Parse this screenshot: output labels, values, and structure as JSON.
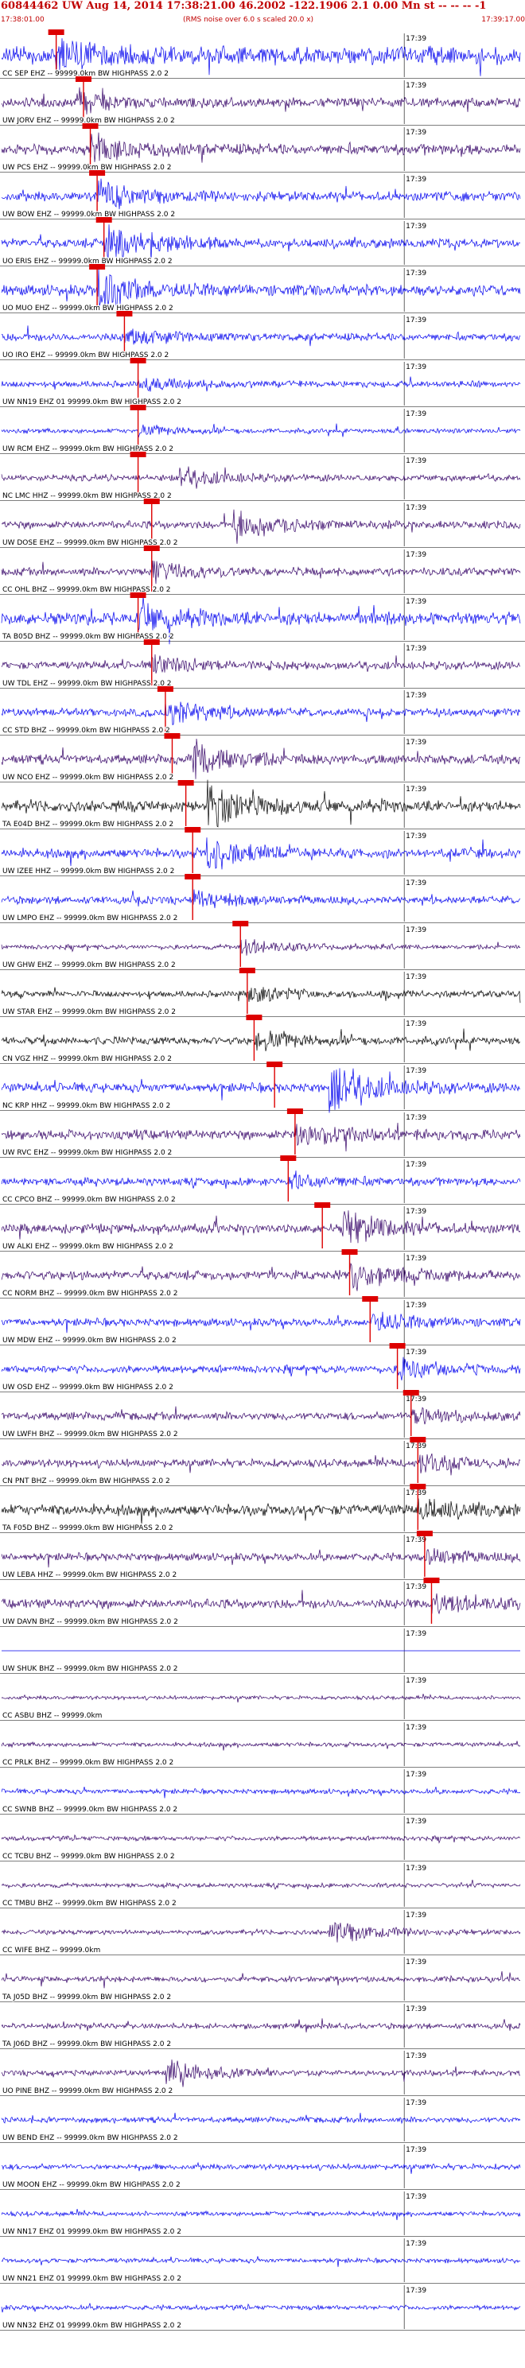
{
  "header": {
    "title": "60844462 UW Aug 14, 2014 17:38:21.00    46.2002 -122.1906  2.1 0.00 Mn st -- -- --  -1",
    "start_time": "17:38:01.00",
    "end_time": "17:39:17.00",
    "rms_note": "(RMS noise over 6.0 s scaled 20.0 x)"
  },
  "colors": {
    "header_red": "#c00000",
    "pick_marker": "#dd0000",
    "trace_colors": [
      "#0000ee",
      "#330066",
      "#000000"
    ]
  },
  "chart_data": {
    "type": "line",
    "title": "60844462 UW Aug 14, 2014 17:38:21.00    46.2002 -122.1906  2.1 0.00 Mn st -- -- --  -1",
    "time_marker_label": "17:39",
    "grid": false,
    "traces": [
      {
        "label": "CC SEP EHZ -- 99999.0km BW  HIGHPASS  2.0  2",
        "color": "#0000ee",
        "amp": 0.55,
        "pick_s": 8,
        "burst_s": 8,
        "burst_amp": 1.0,
        "pick": true
      },
      {
        "label": "UW JORV EHZ -- 99999.0km BW  HIGHPASS  2.0  2",
        "color": "#330066",
        "amp": 0.3,
        "pick_s": 12,
        "burst_s": 11,
        "burst_amp": 0.6,
        "pick": true
      },
      {
        "label": "UW PCS EHZ -- 99999.0km BW  HIGHPASS  2.0  2",
        "color": "#330066",
        "amp": 0.35,
        "pick_s": 13,
        "burst_s": 13,
        "burst_amp": 0.9,
        "pick": true
      },
      {
        "label": "UW BOW EHZ -- 99999.0km BW  HIGHPASS  2.0  2",
        "color": "#0000ee",
        "amp": 0.3,
        "pick_s": 14,
        "burst_s": 14,
        "burst_amp": 0.9,
        "pick": true
      },
      {
        "label": "UO ERIS EHZ -- 99999.0km BW  HIGHPASS  2.0  2",
        "color": "#0000ee",
        "amp": 0.3,
        "pick_s": 15,
        "burst_s": 15,
        "burst_amp": 1.1,
        "pick": true
      },
      {
        "label": "UO MUO EHZ -- 99999.0km BW  HIGHPASS  2.0  2",
        "color": "#0000ee",
        "amp": 0.35,
        "pick_s": 14,
        "burst_s": 14,
        "burst_amp": 1.1,
        "pick": true
      },
      {
        "label": "UO IRO EHZ -- 99999.0km BW  HIGHPASS  2.0  2",
        "color": "#0000ee",
        "amp": 0.25,
        "pick_s": 18,
        "burst_s": 18,
        "burst_amp": 0.5,
        "pick": true
      },
      {
        "label": "UW NN19 EHZ 01 99999.0km BW  HIGHPASS  2.0  2",
        "color": "#0000ee",
        "amp": 0.2,
        "pick_s": 20,
        "burst_s": 20,
        "burst_amp": 0.4,
        "pick": true
      },
      {
        "label": "UW RCM EHZ -- 99999.0km BW  HIGHPASS  2.0  2",
        "color": "#0000ee",
        "amp": 0.15,
        "pick_s": 20,
        "burst_s": 20,
        "burst_amp": 0.3,
        "pick": true
      },
      {
        "label": "NC LMC HHZ -- 99999.0km BW  HIGHPASS  2.0  2",
        "color": "#330066",
        "amp": 0.2,
        "pick_s": 20,
        "burst_s": 26,
        "burst_amp": 0.6,
        "pick": true
      },
      {
        "label": "UW DOSE EHZ -- 99999.0km BW  HIGHPASS  2.0  2",
        "color": "#330066",
        "amp": 0.25,
        "pick_s": 22,
        "burst_s": 34,
        "burst_amp": 1.0,
        "pick": true
      },
      {
        "label": "CC OHL BHZ -- 99999.0km BW  HIGHPASS  2.0  2",
        "color": "#330066",
        "amp": 0.25,
        "pick_s": 22,
        "burst_s": 22,
        "burst_amp": 0.7,
        "pick": true
      },
      {
        "label": "TA B05D BHZ -- 99999.0km BW  HIGHPASS  2.0  2",
        "color": "#0000ee",
        "amp": 0.4,
        "pick_s": 20,
        "burst_s": 20,
        "burst_amp": 0.7,
        "pick": true
      },
      {
        "label": "UW TDL EHZ -- 99999.0km BW  HIGHPASS  2.0  2",
        "color": "#330066",
        "amp": 0.25,
        "pick_s": 22,
        "burst_s": 22,
        "burst_amp": 0.5,
        "pick": true
      },
      {
        "label": "CC STD BHZ -- 99999.0km BW  HIGHPASS  2.0  2",
        "color": "#0000ee",
        "amp": 0.25,
        "pick_s": 24,
        "burst_s": 24,
        "burst_amp": 0.9,
        "pick": true
      },
      {
        "label": "UW NCO EHZ -- 99999.0km BW  HIGHPASS  2.0  2",
        "color": "#330066",
        "amp": 0.3,
        "pick_s": 25,
        "burst_s": 28,
        "burst_amp": 1.1,
        "pick": true
      },
      {
        "label": "TA E04D BHZ -- 99999.0km BW  HIGHPASS  2.0  2",
        "color": "#000000",
        "amp": 0.35,
        "pick_s": 27,
        "burst_s": 30,
        "burst_amp": 1.4,
        "pick": true
      },
      {
        "label": "UW IZEE HHZ -- 99999.0km BW  HIGHPASS  2.0  2",
        "color": "#0000ee",
        "amp": 0.3,
        "pick_s": 28,
        "burst_s": 30,
        "burst_amp": 1.0,
        "pick": true
      },
      {
        "label": "UW LMPO EHZ -- 99999.0km BW  HIGHPASS  2.0  2",
        "color": "#0000ee",
        "amp": 0.25,
        "pick_s": 28,
        "burst_s": 28,
        "burst_amp": 0.5,
        "pick": true
      },
      {
        "label": "UW GHW EHZ -- 99999.0km BW  HIGHPASS  2.0  2",
        "color": "#330066",
        "amp": 0.15,
        "pick_s": 35,
        "burst_s": 35,
        "burst_amp": 0.5,
        "pick": true
      },
      {
        "label": "UW STAR EHZ -- 99999.0km BW  HIGHPASS  2.0  2",
        "color": "#000000",
        "amp": 0.2,
        "pick_s": 36,
        "burst_s": 36,
        "burst_amp": 0.5,
        "pick": true
      },
      {
        "label": "CN VGZ HHZ -- 99999.0km BW  HIGHPASS  2.0  2",
        "color": "#000000",
        "amp": 0.25,
        "pick_s": 37,
        "burst_s": 37,
        "burst_amp": 0.6,
        "pick": true
      },
      {
        "label": "NC KRP HHZ -- 99999.0km BW  HIGHPASS  2.0  2",
        "color": "#0000ee",
        "amp": 0.3,
        "pick_s": 40,
        "burst_s": 48,
        "burst_amp": 1.5,
        "pick": true
      },
      {
        "label": "UW RVC EHZ -- 99999.0km BW  HIGHPASS  2.0  2",
        "color": "#330066",
        "amp": 0.3,
        "pick_s": 43,
        "burst_s": 43,
        "burst_amp": 0.8,
        "pick": true
      },
      {
        "label": "CC CPCO BHZ -- 99999.0km BW  HIGHPASS  2.0  2",
        "color": "#0000ee",
        "amp": 0.25,
        "pick_s": 42,
        "burst_s": 42,
        "burst_amp": 0.5,
        "pick": true
      },
      {
        "label": "UW ALKI EHZ -- 99999.0km BW  HIGHPASS  2.0  2",
        "color": "#330066",
        "amp": 0.3,
        "pick_s": 47,
        "burst_s": 50,
        "burst_amp": 1.0,
        "pick": true
      },
      {
        "label": "CC NORM BHZ -- 99999.0km BW  HIGHPASS  2.0  2",
        "color": "#330066",
        "amp": 0.3,
        "pick_s": 51,
        "burst_s": 51,
        "burst_amp": 0.9,
        "pick": true
      },
      {
        "label": "UW MDW EHZ -- 99999.0km BW  HIGHPASS  2.0  2",
        "color": "#0000ee",
        "amp": 0.25,
        "pick_s": 54,
        "burst_s": 54,
        "burst_amp": 0.6,
        "pick": true
      },
      {
        "label": "UW OSD EHZ -- 99999.0km BW  HIGHPASS  2.0  2",
        "color": "#0000ee",
        "amp": 0.25,
        "pick_s": 58,
        "burst_s": 58,
        "burst_amp": 0.6,
        "pick": true
      },
      {
        "label": "UW LWFH BHZ -- 99999.0km BW  HIGHPASS  2.0  2",
        "color": "#330066",
        "amp": 0.25,
        "pick_s": 60,
        "burst_s": 60,
        "burst_amp": 0.5,
        "pick": true
      },
      {
        "label": "CN PNT BHZ -- 99999.0km BW  HIGHPASS  2.0  2",
        "color": "#330066",
        "amp": 0.25,
        "pick_s": 61,
        "burst_s": 61,
        "burst_amp": 0.6,
        "pick": true
      },
      {
        "label": "TA F05D BHZ -- 99999.0km BW  HIGHPASS  2.0  2",
        "color": "#000000",
        "amp": 0.35,
        "pick_s": 61,
        "burst_s": 61,
        "burst_amp": 0.6,
        "pick": true
      },
      {
        "label": "UW LEBA HHZ -- 99999.0km BW  HIGHPASS  2.0  2",
        "color": "#330066",
        "amp": 0.25,
        "pick_s": 62,
        "burst_s": 62,
        "burst_amp": 0.5,
        "pick": true
      },
      {
        "label": "UW DAVN BHZ -- 99999.0km BW  HIGHPASS  2.0  2",
        "color": "#330066",
        "amp": 0.3,
        "pick_s": 63,
        "burst_s": 63,
        "burst_amp": 0.6,
        "pick": true
      },
      {
        "label": "UW SHUK BHZ -- 99999.0km BW  HIGHPASS  2.0  2",
        "color": "#0000ee",
        "amp": 0.0,
        "pick_s": 0,
        "burst_s": 0,
        "burst_amp": 0.0,
        "pick": false
      },
      {
        "label": "CC ASBU BHZ -- 99999.0km",
        "color": "#330066",
        "amp": 0.12,
        "pick_s": 0,
        "burst_s": 0,
        "burst_amp": 0.0,
        "pick": false
      },
      {
        "label": "CC PRLK BHZ -- 99999.0km BW  HIGHPASS  2.0  2",
        "color": "#330066",
        "amp": 0.14,
        "pick_s": 0,
        "burst_s": 0,
        "burst_amp": 0.0,
        "pick": false
      },
      {
        "label": "CC SWNB BHZ -- 99999.0km BW  HIGHPASS  2.0  2",
        "color": "#0000ee",
        "amp": 0.16,
        "pick_s": 0,
        "burst_s": 0,
        "burst_amp": 0.0,
        "pick": false
      },
      {
        "label": "CC TCBU BHZ -- 99999.0km BW  HIGHPASS  2.0  2",
        "color": "#330066",
        "amp": 0.15,
        "pick_s": 0,
        "burst_s": 0,
        "burst_amp": 0.0,
        "pick": false
      },
      {
        "label": "CC TMBU BHZ -- 99999.0km BW  HIGHPASS  2.0  2",
        "color": "#330066",
        "amp": 0.14,
        "pick_s": 0,
        "burst_s": 0,
        "burst_amp": 0.0,
        "pick": false
      },
      {
        "label": "CC WIFE BHZ -- 99999.0km",
        "color": "#330066",
        "amp": 0.15,
        "pick_s": 0,
        "burst_s": 48,
        "burst_amp": 0.8,
        "pick": false
      },
      {
        "label": "TA J05D BHZ -- 99999.0km BW  HIGHPASS  2.0  2",
        "color": "#330066",
        "amp": 0.18,
        "pick_s": 0,
        "burst_s": 0,
        "burst_amp": 0.0,
        "pick": false
      },
      {
        "label": "TA J06D BHZ -- 99999.0km BW  HIGHPASS  2.0  2",
        "color": "#330066",
        "amp": 0.18,
        "pick_s": 0,
        "burst_s": 0,
        "burst_amp": 0.0,
        "pick": false
      },
      {
        "label": "UO PINE BHZ -- 99999.0km BW  HIGHPASS  2.0  2",
        "color": "#330066",
        "amp": 0.18,
        "pick_s": 0,
        "burst_s": 24,
        "burst_amp": 0.8,
        "pick": false
      },
      {
        "label": "UW BEND EHZ -- 99999.0km BW  HIGHPASS  2.0  2",
        "color": "#0000ee",
        "amp": 0.18,
        "pick_s": 0,
        "burst_s": 0,
        "burst_amp": 0.0,
        "pick": false
      },
      {
        "label": "UW MOON EHZ -- 99999.0km BW  HIGHPASS  2.0  2",
        "color": "#0000ee",
        "amp": 0.18,
        "pick_s": 0,
        "burst_s": 0,
        "burst_amp": 0.0,
        "pick": false
      },
      {
        "label": "UW NN17 EHZ 01 99999.0km BW  HIGHPASS  2.0  2",
        "color": "#0000ee",
        "amp": 0.15,
        "pick_s": 0,
        "burst_s": 0,
        "burst_amp": 0.0,
        "pick": false
      },
      {
        "label": "UW NN21 EHZ 01 99999.0km BW  HIGHPASS  2.0  2",
        "color": "#0000ee",
        "amp": 0.15,
        "pick_s": 0,
        "burst_s": 0,
        "burst_amp": 0.0,
        "pick": false
      },
      {
        "label": "UW NN32 EHZ 01 99999.0km BW  HIGHPASS  2.0  2",
        "color": "#0000ee",
        "amp": 0.15,
        "pick_s": 0,
        "burst_s": 0,
        "burst_amp": 0.0,
        "pick": false
      }
    ]
  }
}
